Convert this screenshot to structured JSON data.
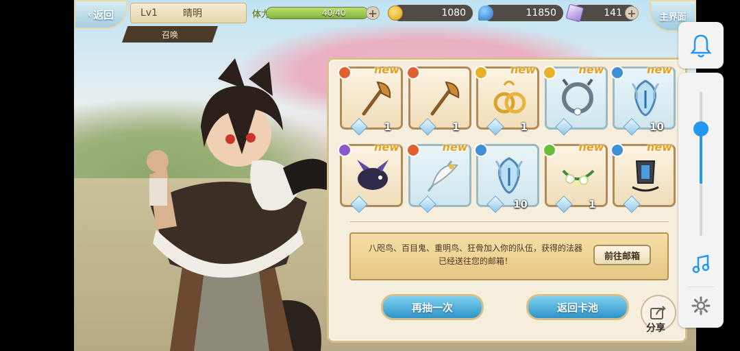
{
  "header": {
    "back_label": "返回",
    "level": "Lv1",
    "player_name": "晴明",
    "summon_label": "召唤",
    "stamina_label": "体力",
    "stamina_value": "40/40",
    "stamina_fraction": 1.0,
    "gold": "1080",
    "mana": "11850",
    "crystal": "141",
    "home_label": "主界面"
  },
  "items": [
    {
      "name": "axe",
      "element_color": "#e0612e",
      "new": "new",
      "count": "1",
      "tone": "gold"
    },
    {
      "name": "axe",
      "element_color": "#e0612e",
      "new": "",
      "count": "1",
      "tone": "gold"
    },
    {
      "name": "rings",
      "element_color": "#e6b22a",
      "new": "new",
      "count": "1",
      "tone": "gold"
    },
    {
      "name": "silver-ring",
      "element_color": "#e6b22a",
      "new": "new",
      "count": "",
      "tone": "blue"
    },
    {
      "name": "ice-lantern",
      "element_color": "#3d8fd6",
      "new": "new",
      "count": "10",
      "tone": "blue"
    },
    {
      "name": "dark-bird",
      "element_color": "#8a58c8",
      "new": "new",
      "count": "",
      "tone": "gold"
    },
    {
      "name": "feather-fan",
      "element_color": "#e0612e",
      "new": "new",
      "count": "",
      "tone": "blue"
    },
    {
      "name": "ice-lantern",
      "element_color": "#3d8fd6",
      "new": "",
      "count": "10",
      "tone": "blue"
    },
    {
      "name": "flower-wreath",
      "element_color": "#6cbb3a",
      "new": "new",
      "count": "1",
      "tone": "gold"
    },
    {
      "name": "dark-lantern",
      "element_color": "#3d8fd6",
      "new": "new",
      "count": "",
      "tone": "gold"
    }
  ],
  "message": {
    "line1": "八咫鸟、百目鬼、重明鸟、狂骨加入你的队伍，获得的法器",
    "line2": "已经送往您的邮箱！",
    "mail_button": "前往邮箱"
  },
  "actions": {
    "draw_again": "再抽一次",
    "return_pool": "返回卡池",
    "share": "分享"
  },
  "system_panel": {
    "volume_fraction": 0.38
  }
}
